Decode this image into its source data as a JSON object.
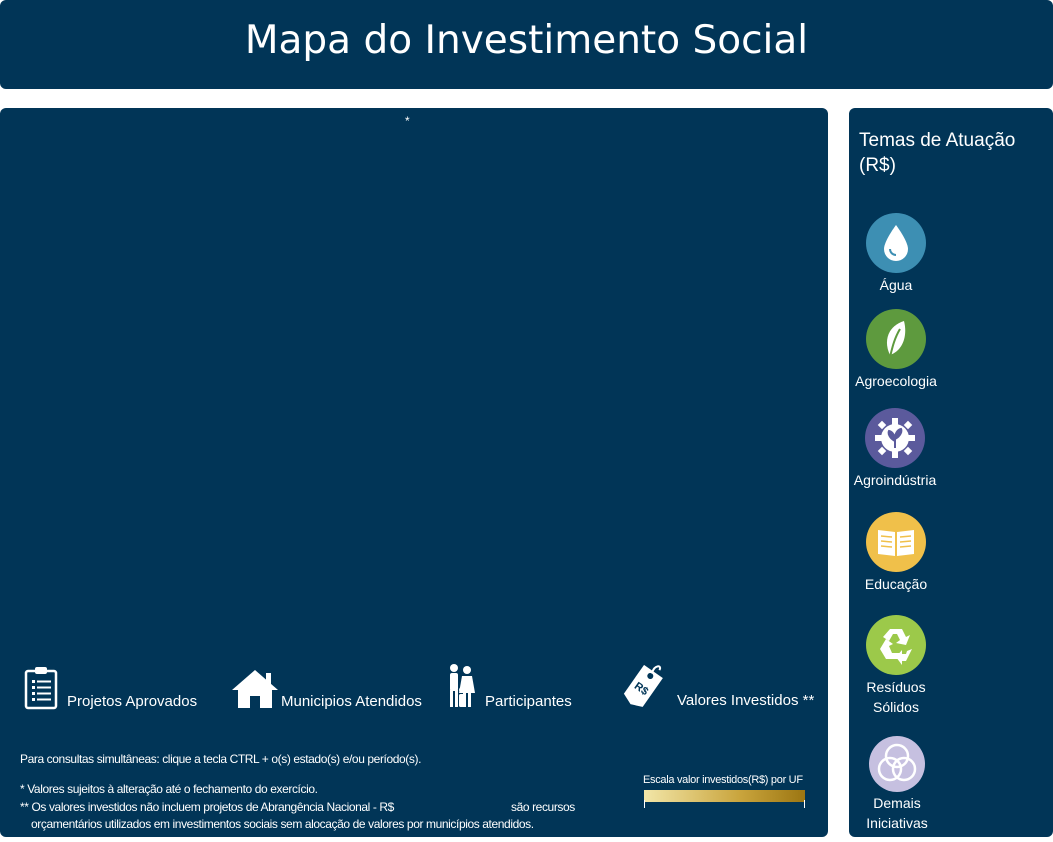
{
  "header": {
    "title": "Mapa do Investimento Social"
  },
  "map": {
    "asterisk": "*"
  },
  "stats": {
    "projetos": "Projetos Aprovados",
    "municipios": "Municipios Atendidos",
    "participantes": "Participantes",
    "valores": "Valores Investidos **",
    "valores_icon_text": "R$"
  },
  "notes": {
    "ctrl": "Para consultas simultâneas: clique a tecla CTRL  +  o(s) estado(s) e/ou período(s).",
    "n1": "* Valores sujeitos à alteração até o fechamento do exercício.",
    "n2a": "** Os valores investidos não incluem projetos de Abrangência Nacional - R$",
    "n2b": "são recursos",
    "n3": "orçamentários utilizados em investimentos sociais sem alocação de valores por municípios atendidos."
  },
  "scale": {
    "label": "Escala valor investidos(R$)  por  UF",
    "colors": [
      "#f2e6a8",
      "#c9a43c",
      "#9c7612"
    ]
  },
  "sidebar": {
    "title": "Temas de Atuação (R$)",
    "themes": [
      {
        "label": "Água",
        "icon": "water-drop-icon",
        "color": "#3d8fb3"
      },
      {
        "label": "Agroecologia",
        "icon": "leaf-icon",
        "color": "#5e9a3e"
      },
      {
        "label": "Agroindústria",
        "icon": "gear-plant-icon",
        "color": "#5b5a9c"
      },
      {
        "label": "Educação",
        "icon": "book-icon",
        "color": "#f0c04a"
      },
      {
        "label1": "Resíduos",
        "label2": "Sólidos",
        "icon": "recycle-icon",
        "color": "#9cc94a"
      },
      {
        "label1": "Demais",
        "label2": "Iniciativas",
        "icon": "circles-icon",
        "color": "#c6c0e0"
      }
    ]
  }
}
